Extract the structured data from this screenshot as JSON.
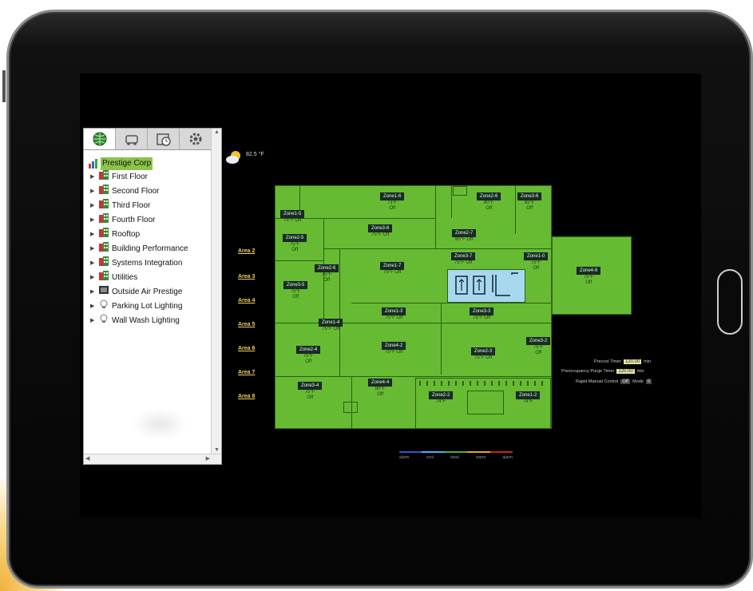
{
  "sidebar": {
    "tabs": [
      {
        "icon": "globe-icon"
      },
      {
        "icon": "vehicle-icon"
      },
      {
        "icon": "calendar-clock-icon"
      },
      {
        "icon": "gear-icon"
      }
    ],
    "root": {
      "label": "Prestige Corp",
      "icon": "bar-chart-icon"
    },
    "items": [
      {
        "label": "First Floor",
        "icon": "building-icon"
      },
      {
        "label": "Second Floor",
        "icon": "building-icon"
      },
      {
        "label": "Third Floor",
        "icon": "building-icon"
      },
      {
        "label": "Fourth Floor",
        "icon": "building-icon"
      },
      {
        "label": "Rooftop",
        "icon": "building-icon"
      },
      {
        "label": "Building Performance",
        "icon": "building-icon"
      },
      {
        "label": "Systems Integration",
        "icon": "building-icon"
      },
      {
        "label": "Utilities",
        "icon": "building-icon"
      },
      {
        "label": "Outside Air Prestige",
        "icon": "device-icon"
      },
      {
        "label": "Parking Lot Lighting",
        "icon": "bulb-icon"
      },
      {
        "label": "Wall Wash Lighting",
        "icon": "bulb-icon"
      }
    ]
  },
  "weather": {
    "temp": "82.5 °F",
    "icon": "partly-cloudy-icon"
  },
  "areas": [
    "Area 2",
    "Area 3",
    "Area 4",
    "Area 5",
    "Area 6",
    "Area 7",
    "Area 8"
  ],
  "zones": [
    {
      "name": "Zone1-6",
      "line1": "73°F",
      "line2": "Off"
    },
    {
      "name": "Zone2-6",
      "line1": "80°F",
      "line2": "Off"
    },
    {
      "name": "Zone3-6",
      "line1": "82°F",
      "line2": "Off"
    },
    {
      "name": "Zone1-5",
      "line1": "75°F Off",
      "line2": ""
    },
    {
      "name": "Zone3-6",
      "line1": "75°F Off",
      "line2": ""
    },
    {
      "name": "Zone2-7",
      "line1": "80°F Off",
      "line2": ""
    },
    {
      "name": "Zone2-5",
      "line1": "75°F",
      "line2": "Off"
    },
    {
      "name": "Zone3-7",
      "line1": "75°F Off",
      "line2": ""
    },
    {
      "name": "Zone1-0",
      "line1": "75°F",
      "line2": "Off"
    },
    {
      "name": "Zone2-6",
      "line1": "75°F",
      "line2": "Off"
    },
    {
      "name": "Zone1-7",
      "line1": "75°F Off",
      "line2": ""
    },
    {
      "name": "Zone3-5",
      "line1": "75°F",
      "line2": "Off"
    },
    {
      "name": "Zone1-4",
      "line1": "75°F Off",
      "line2": ""
    },
    {
      "name": "Zone1-3",
      "line1": "75°F Off",
      "line2": ""
    },
    {
      "name": "Zone3-3",
      "line1": "75°F Off",
      "line2": ""
    },
    {
      "name": "Zone2-4",
      "line1": "75°F",
      "line2": "Off"
    },
    {
      "name": "Zone4-2",
      "line1": "75°F Off",
      "line2": ""
    },
    {
      "name": "Zone2-3",
      "line1": "75°F Off",
      "line2": ""
    },
    {
      "name": "Zone3-2",
      "line1": "75°F",
      "line2": "Off"
    },
    {
      "name": "Zone3-4",
      "line1": "75°F",
      "line2": "Off"
    },
    {
      "name": "Zone4-4",
      "line1": "80°F",
      "line2": "Off"
    },
    {
      "name": "Zone2-2",
      "line1": "74°F",
      "line2": ""
    },
    {
      "name": "Zone1-2",
      "line1": "74°F",
      "line2": ""
    },
    {
      "name": "Zone4-6",
      "line1": "75°F",
      "line2": "Off"
    }
  ],
  "controls": {
    "precool_label": "Precool Timer",
    "precool_value": "120.00",
    "precool_unit": "min",
    "purge_label": "Preoccupancy Purge Timer",
    "purge_value": "120.00",
    "purge_unit": "min",
    "rapid_label": "Rapid Manual Control",
    "rapid_value": "Off",
    "mode_label": "Mode",
    "mode_value": "0"
  },
  "legend": {
    "labels": [
      "alarm",
      "cool",
      "ideal",
      "warm",
      "alarm"
    ],
    "colors": [
      "#3355cc",
      "#55aaff",
      "#55aa33",
      "#ddaa22",
      "#cc2222"
    ]
  }
}
